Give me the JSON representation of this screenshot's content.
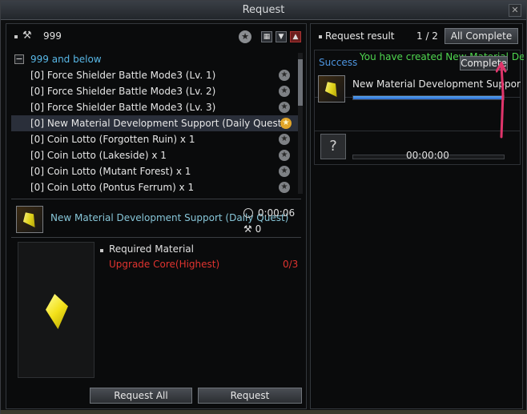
{
  "window": {
    "title": "Request",
    "close_label": "✕"
  },
  "left": {
    "header_count": "999",
    "group_label": "999 and below",
    "items": [
      {
        "label": "[0] Force Shielder Battle Mode3 (Lv. 1)"
      },
      {
        "label": "[0] Force Shielder Battle Mode3 (Lv. 2)"
      },
      {
        "label": "[0] Force Shielder Battle Mode3 (Lv. 3)"
      },
      {
        "label": "[0] New Material Development Support (Daily Quest)"
      },
      {
        "label": "[0] Coin Lotto (Forgotten Ruin) x 1"
      },
      {
        "label": "[0] Coin Lotto (Lakeside) x 1"
      },
      {
        "label": "[0] Coin Lotto (Mutant Forest) x 1"
      },
      {
        "label": "[0] Coin Lotto (Pontus Ferrum) x 1"
      }
    ],
    "detail": {
      "name": "New Material Development Support (Daily Quest)",
      "time": "0:00:06",
      "cost": "0",
      "required_label": "Required Material",
      "material_name": "Upgrade Core(Highest)",
      "material_count": "0/3"
    },
    "buttons": {
      "request_all": "Request All",
      "request": "Request"
    }
  },
  "right": {
    "title": "Request result",
    "page": "1 / 2",
    "all_complete": "All Complete",
    "slot1": {
      "status": "Success",
      "message": "You have created New Material Deve",
      "complete_label": "Complete",
      "name": "New Material Development Suppor (D",
      "progress": 1.0
    },
    "slot2": {
      "icon_label": "?",
      "time": "00:00:00"
    }
  },
  "colors": {
    "group": "#58b7e6",
    "material_red": "#e0332f",
    "success_blue": "#4d95e0",
    "message_green": "#4fd64f",
    "arrow_pink": "#e0356b"
  }
}
